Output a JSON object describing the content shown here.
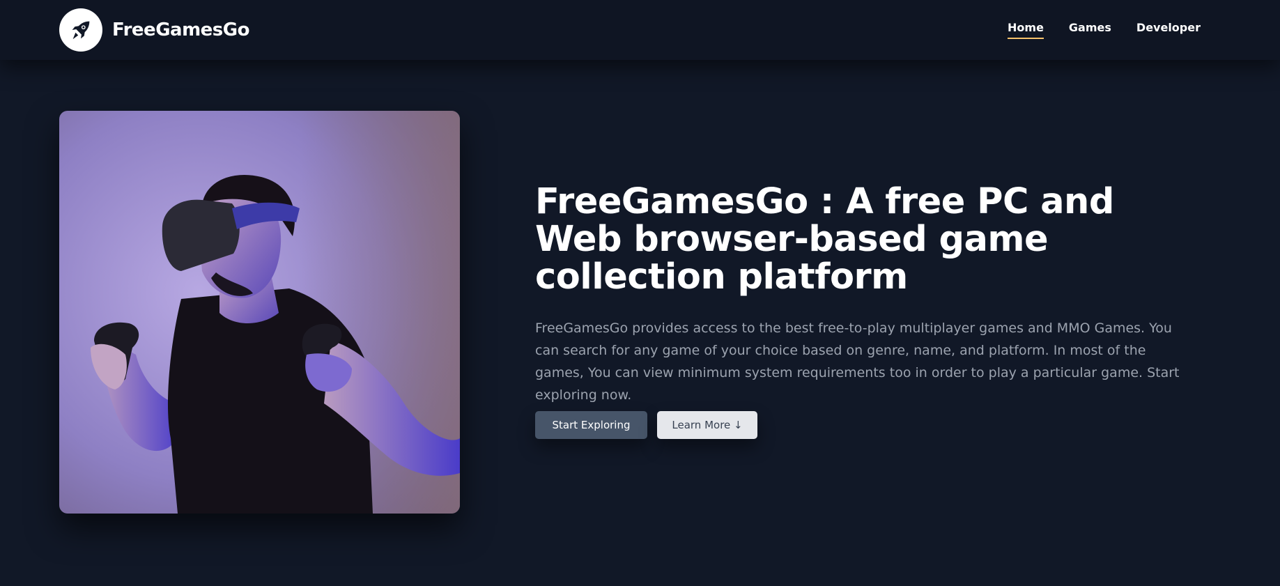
{
  "header": {
    "brand_name": "FreeGamesGo",
    "logo_icon": "rocket-icon",
    "nav": [
      {
        "label": "Home",
        "active": true
      },
      {
        "label": "Games",
        "active": false
      },
      {
        "label": "Developer",
        "active": false
      }
    ],
    "accent_color": "#f6c26b"
  },
  "hero": {
    "image_icon": "vr-gamer-photo",
    "title": "FreeGamesGo : A free PC and Web browser-based game collection platform",
    "description": "FreeGamesGo provides access to the best free-to-play multiplayer games and MMO Games. You can search for any game of your choice based on genre, name, and platform. In most of the games, You can view minimum system requirements too in order to play a particular game. Start exploring now.",
    "primary_button": "Start Exploring",
    "secondary_button": "Learn More ↓"
  },
  "colors": {
    "background": "#111827",
    "navbar": "#0f1523",
    "primary_button": "#475569",
    "secondary_button": "#e5e7eb",
    "body_text": "#9ca3af"
  }
}
